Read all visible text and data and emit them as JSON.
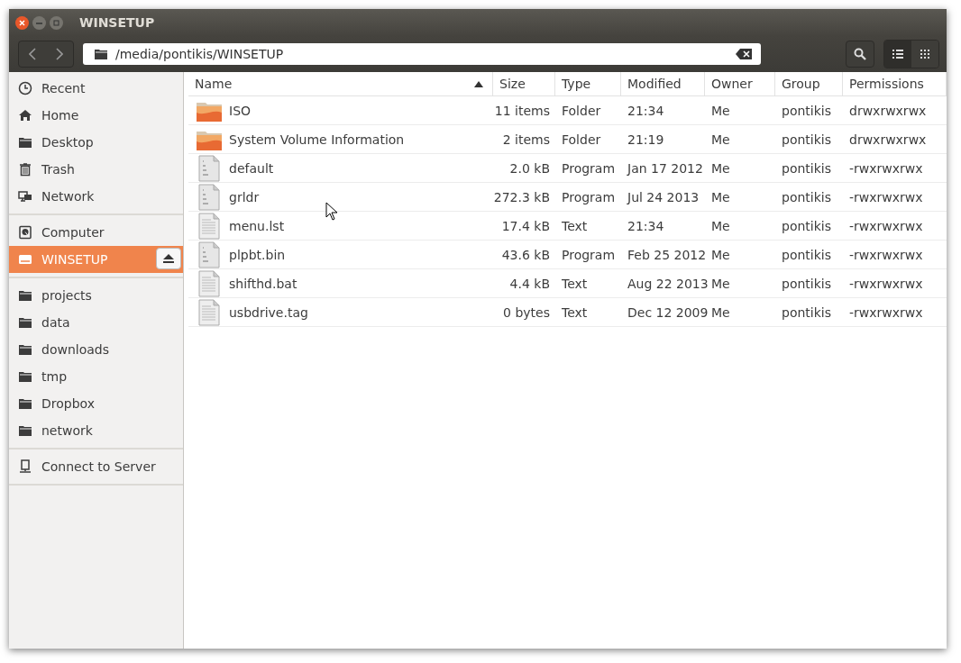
{
  "window": {
    "title": "WINSETUP"
  },
  "location": {
    "path": "/media/pontikis/WINSETUP"
  },
  "view_buttons": [
    {
      "kind": "list",
      "selected": true
    },
    {
      "kind": "grid",
      "selected": false
    }
  ],
  "sidebar": {
    "sections": [
      {
        "items": [
          {
            "kind": "recent",
            "label": "Recent",
            "selected": false,
            "eject": false
          },
          {
            "kind": "home",
            "label": "Home",
            "selected": false,
            "eject": false
          },
          {
            "kind": "folder",
            "label": "Desktop",
            "selected": false,
            "eject": false
          },
          {
            "kind": "trash",
            "label": "Trash",
            "selected": false,
            "eject": false
          },
          {
            "kind": "network",
            "label": "Network",
            "selected": false,
            "eject": false
          }
        ]
      },
      {
        "items": [
          {
            "kind": "computer",
            "label": "Computer",
            "selected": false,
            "eject": false
          },
          {
            "kind": "drive",
            "label": "WINSETUP",
            "selected": true,
            "eject": true
          }
        ]
      },
      {
        "items": [
          {
            "kind": "folder",
            "label": "projects",
            "selected": false,
            "eject": false
          },
          {
            "kind": "folder",
            "label": "data",
            "selected": false,
            "eject": false
          },
          {
            "kind": "folder",
            "label": "downloads",
            "selected": false,
            "eject": false
          },
          {
            "kind": "folder",
            "label": "tmp",
            "selected": false,
            "eject": false
          },
          {
            "kind": "folder",
            "label": "Dropbox",
            "selected": false,
            "eject": false
          },
          {
            "kind": "folder",
            "label": "network",
            "selected": false,
            "eject": false
          }
        ]
      },
      {
        "items": [
          {
            "kind": "server",
            "label": "Connect to Server",
            "selected": false,
            "eject": false
          }
        ]
      }
    ]
  },
  "table": {
    "columns": [
      {
        "label": "Name",
        "sorted": true
      },
      {
        "label": "Size",
        "sorted": false
      },
      {
        "label": "Type",
        "sorted": false
      },
      {
        "label": "Modified",
        "sorted": false
      },
      {
        "label": "Owner",
        "sorted": false
      },
      {
        "label": "Group",
        "sorted": false
      },
      {
        "label": "Permissions",
        "sorted": false
      }
    ],
    "rows": [
      {
        "kind": "folder",
        "name": "ISO",
        "size": "11 items",
        "type": "Folder",
        "modified": "21:34",
        "owner": "Me",
        "group": "pontikis",
        "permissions": "drwxrwxrwx"
      },
      {
        "kind": "folder",
        "name": "System Volume Information",
        "size": "2 items",
        "type": "Folder",
        "modified": "21:19",
        "owner": "Me",
        "group": "pontikis",
        "permissions": "drwxrwxrwx"
      },
      {
        "kind": "binary",
        "name": "default",
        "size": "2.0 kB",
        "type": "Program",
        "modified": "Jan 17 2012",
        "owner": "Me",
        "group": "pontikis",
        "permissions": "-rwxrwxrwx"
      },
      {
        "kind": "binary",
        "name": "grldr",
        "size": "272.3 kB",
        "type": "Program",
        "modified": "Jul 24 2013",
        "owner": "Me",
        "group": "pontikis",
        "permissions": "-rwxrwxrwx"
      },
      {
        "kind": "text",
        "name": "menu.lst",
        "size": "17.4 kB",
        "type": "Text",
        "modified": "21:34",
        "owner": "Me",
        "group": "pontikis",
        "permissions": "-rwxrwxrwx"
      },
      {
        "kind": "binary",
        "name": "plpbt.bin",
        "size": "43.6 kB",
        "type": "Program",
        "modified": "Feb 25 2012",
        "owner": "Me",
        "group": "pontikis",
        "permissions": "-rwxrwxrwx"
      },
      {
        "kind": "text",
        "name": "shifthd.bat",
        "size": "4.4 kB",
        "type": "Text",
        "modified": "Aug 22 2013",
        "owner": "Me",
        "group": "pontikis",
        "permissions": "-rwxrwxrwx"
      },
      {
        "kind": "text",
        "name": "usbdrive.tag",
        "size": "0 bytes",
        "type": "Text",
        "modified": "Dec 12 2009",
        "owner": "Me",
        "group": "pontikis",
        "permissions": "-rwxrwxrwx"
      }
    ]
  }
}
